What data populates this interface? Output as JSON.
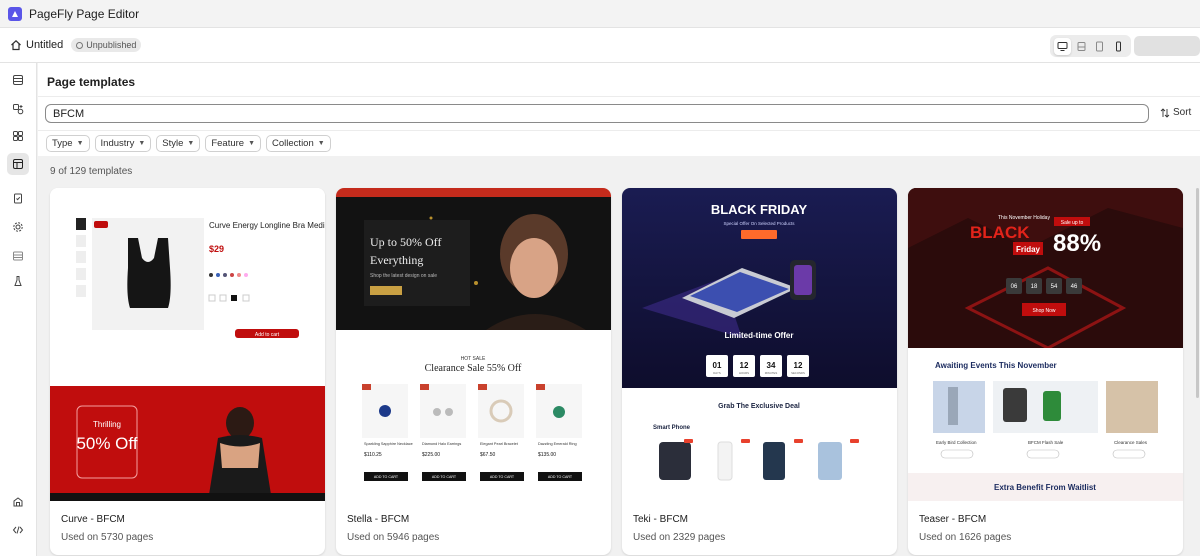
{
  "app": {
    "title": "PageFly Page Editor"
  },
  "header": {
    "page_name": "Untitled",
    "status": "Unpublished"
  },
  "panel": {
    "title": "Page templates",
    "search_value": "BFCM",
    "sort_label": "Sort",
    "filters": [
      "Type",
      "Industry",
      "Style",
      "Feature",
      "Collection"
    ],
    "count_text": "9 of 129 templates"
  },
  "templates": [
    {
      "name": "Curve - BFCM",
      "usage": "Used on 5730 pages"
    },
    {
      "name": "Stella - BFCM",
      "usage": "Used on 5946 pages"
    },
    {
      "name": "Teki - BFCM",
      "usage": "Used on 2329 pages"
    },
    {
      "name": "Teaser - BFCM",
      "usage": "Used on 1626 pages"
    }
  ],
  "previews": {
    "curve": {
      "product_title": "Curve Energy Longline Bra Medium Support",
      "price": "$29",
      "banner_heading": "Thrilling",
      "banner_offer": "50% Off",
      "add_to_cart": "Add to cart"
    },
    "stella": {
      "hero_line1": "Up to 50% Off",
      "hero_line2": "Everything",
      "hero_sub": "Shop the latest design on sale",
      "kicker": "HOT SALE",
      "section_title": "Clearance Sale 55% Off",
      "products": [
        {
          "name": "Sparkling Sapphire Necklace",
          "price": "$110.25"
        },
        {
          "name": "Diamond Halo Earrings",
          "price": "$225.00"
        },
        {
          "name": "Elegant Pearl Bracelet",
          "price": "$67.50"
        },
        {
          "name": "Dazzling Emerald Ring",
          "price": "$135.00"
        }
      ],
      "add_to_cart": "ADD TO CART"
    },
    "teki": {
      "hero_title": "BLACK FRIDAY",
      "hero_sub": "Special Offer On Selected Products",
      "limited": "Limited-time Offer",
      "countdown": [
        {
          "value": "01",
          "unit": "DAYS"
        },
        {
          "value": "12",
          "unit": "HOURS"
        },
        {
          "value": "34",
          "unit": "MINUTES"
        },
        {
          "value": "12",
          "unit": "SECONDS"
        }
      ],
      "section_title": "Grab The Exclusive Deal",
      "category": "Smart Phone"
    },
    "teaser": {
      "kicker": "This November Holiday",
      "sale_up_to": "Sale up to",
      "black": "BLACK",
      "friday": "Friday",
      "percent": "88%",
      "countdown": [
        "06",
        "18",
        "54",
        "46"
      ],
      "shop_now": "Shop Now",
      "section_title": "Awaiting Events This November",
      "events": [
        "Early Bird Collection",
        "BFCM Flash Sale",
        "Clearance Sales"
      ],
      "extra": "Extra Benefit From Waitlist"
    }
  },
  "colors": {
    "brand": "#5a55e8",
    "red": "#c00d0d",
    "stella_dark": "#111111",
    "teki_navy": "#17163f"
  }
}
